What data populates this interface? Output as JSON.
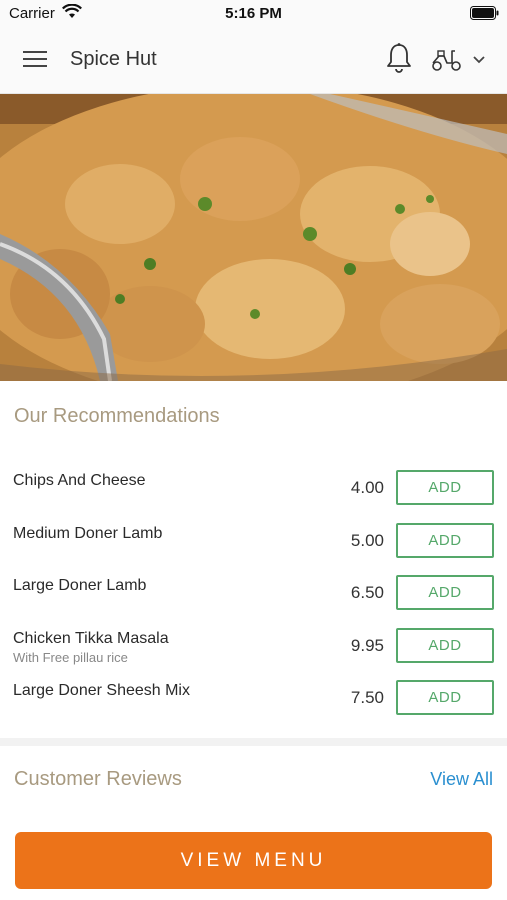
{
  "status_bar": {
    "carrier": "Carrier",
    "time": "5:16 PM"
  },
  "header": {
    "title": "Spice Hut",
    "icons": [
      "menu-icon",
      "bell-icon",
      "scooter-icon",
      "chevron-down-icon"
    ]
  },
  "hero": {
    "image": "curry dish photo"
  },
  "recommendations": {
    "title": "Our Recommendations",
    "add_label": "ADD",
    "items": [
      {
        "name": "Chips And Cheese",
        "subtitle": "",
        "price": "4.00"
      },
      {
        "name": "Medium Doner Lamb",
        "subtitle": "",
        "price": "5.00"
      },
      {
        "name": "Large Doner Lamb",
        "subtitle": "",
        "price": "6.50"
      },
      {
        "name": "Chicken Tikka Masala",
        "subtitle": "With Free pillau rice",
        "price": "9.95"
      },
      {
        "name": "Large Doner Sheesh Mix",
        "subtitle": "",
        "price": "7.50"
      }
    ]
  },
  "reviews": {
    "title": "Customer Reviews",
    "view_all": "View All"
  },
  "cta": {
    "label": "VIEW MENU"
  },
  "colors": {
    "accent": "#ec7319",
    "add_green": "#55a86a",
    "link_blue": "#2a8fd0",
    "section_title": "#a89a80"
  }
}
